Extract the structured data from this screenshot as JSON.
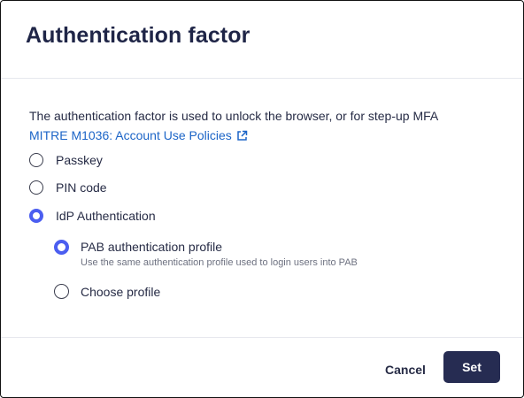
{
  "dialog": {
    "title": "Authentication factor",
    "description": "The authentication factor is used to unlock the browser, or for step-up MFA",
    "policy_link": {
      "label": "MITRE M1036: Account Use Policies",
      "icon": "external-link-icon"
    },
    "options": [
      {
        "label": "Passkey",
        "selected": false
      },
      {
        "label": "PIN code",
        "selected": false
      },
      {
        "label": "IdP Authentication",
        "selected": true
      }
    ],
    "idp_sub_options": [
      {
        "label": "PAB authentication profile",
        "hint": "Use the same authentication profile used to login users into PAB",
        "selected": true
      },
      {
        "label": "Choose profile",
        "selected": false
      }
    ],
    "footer": {
      "cancel_label": "Cancel",
      "set_label": "Set"
    }
  },
  "colors": {
    "accent": "#4b5ef0",
    "link": "#1b64c7",
    "primary_button": "#262c52",
    "title": "#1f2547"
  }
}
